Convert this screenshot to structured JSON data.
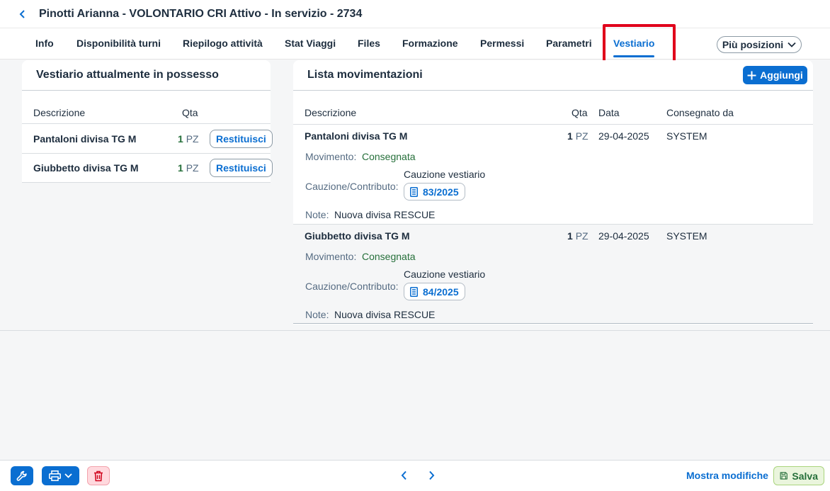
{
  "header": {
    "title": "Pinotti Arianna - VOLONTARIO CRI Attivo - In servizio - 2734",
    "tabs": [
      {
        "label": "Info"
      },
      {
        "label": "Disponibilità turni"
      },
      {
        "label": "Riepilogo attività"
      },
      {
        "label": "Stat Viaggi"
      },
      {
        "label": "Files"
      },
      {
        "label": "Formazione"
      },
      {
        "label": "Permessi"
      },
      {
        "label": "Parametri"
      },
      {
        "label": "Vestiario"
      }
    ],
    "active_tab": "Vestiario",
    "more_label": "Più posizioni"
  },
  "left_panel": {
    "title": "Vestiario attualmente in possesso",
    "columns": {
      "description": "Descrizione",
      "qty": "Qta"
    },
    "rows": [
      {
        "description": "Pantaloni divisa TG M",
        "qty": "1",
        "unit": "PZ",
        "action": "Restituisci"
      },
      {
        "description": "Giubbetto divisa TG M",
        "qty": "1",
        "unit": "PZ",
        "action": "Restituisci"
      }
    ]
  },
  "right_panel": {
    "title": "Lista movimentazioni",
    "add_label": "Aggiungi",
    "columns": {
      "description": "Descrizione",
      "qty": "Qta",
      "date": "Data",
      "delivered_by": "Consegnato da"
    },
    "rows": [
      {
        "description": "Pantaloni divisa TG M",
        "qty": "1",
        "unit": "PZ",
        "date": "29-04-2025",
        "delivered_by": "SYSTEM",
        "movement_label": "Movimento:",
        "movement_value": "Consegnata",
        "deposit_label": "Cauzione/Contributo:",
        "deposit_title": "Cauzione vestiario",
        "deposit_doc": "83/2025",
        "notes_label": "Note:",
        "notes_value": "Nuova divisa RESCUE"
      },
      {
        "description": "Giubbetto divisa TG M",
        "qty": "1",
        "unit": "PZ",
        "date": "29-04-2025",
        "delivered_by": "SYSTEM",
        "movement_label": "Movimento:",
        "movement_value": "Consegnata",
        "deposit_label": "Cauzione/Contributo:",
        "deposit_title": "Cauzione vestiario",
        "deposit_doc": "84/2025",
        "notes_label": "Note:",
        "notes_value": "Nuova divisa RESCUE"
      }
    ]
  },
  "footer": {
    "show_changes_label": "Mostra modifiche",
    "save_label": "Salva"
  },
  "colors": {
    "accent": "#0a6ed1",
    "positive": "#256f3a",
    "highlight": "#e0001b",
    "danger_bg": "#ffd9de"
  }
}
